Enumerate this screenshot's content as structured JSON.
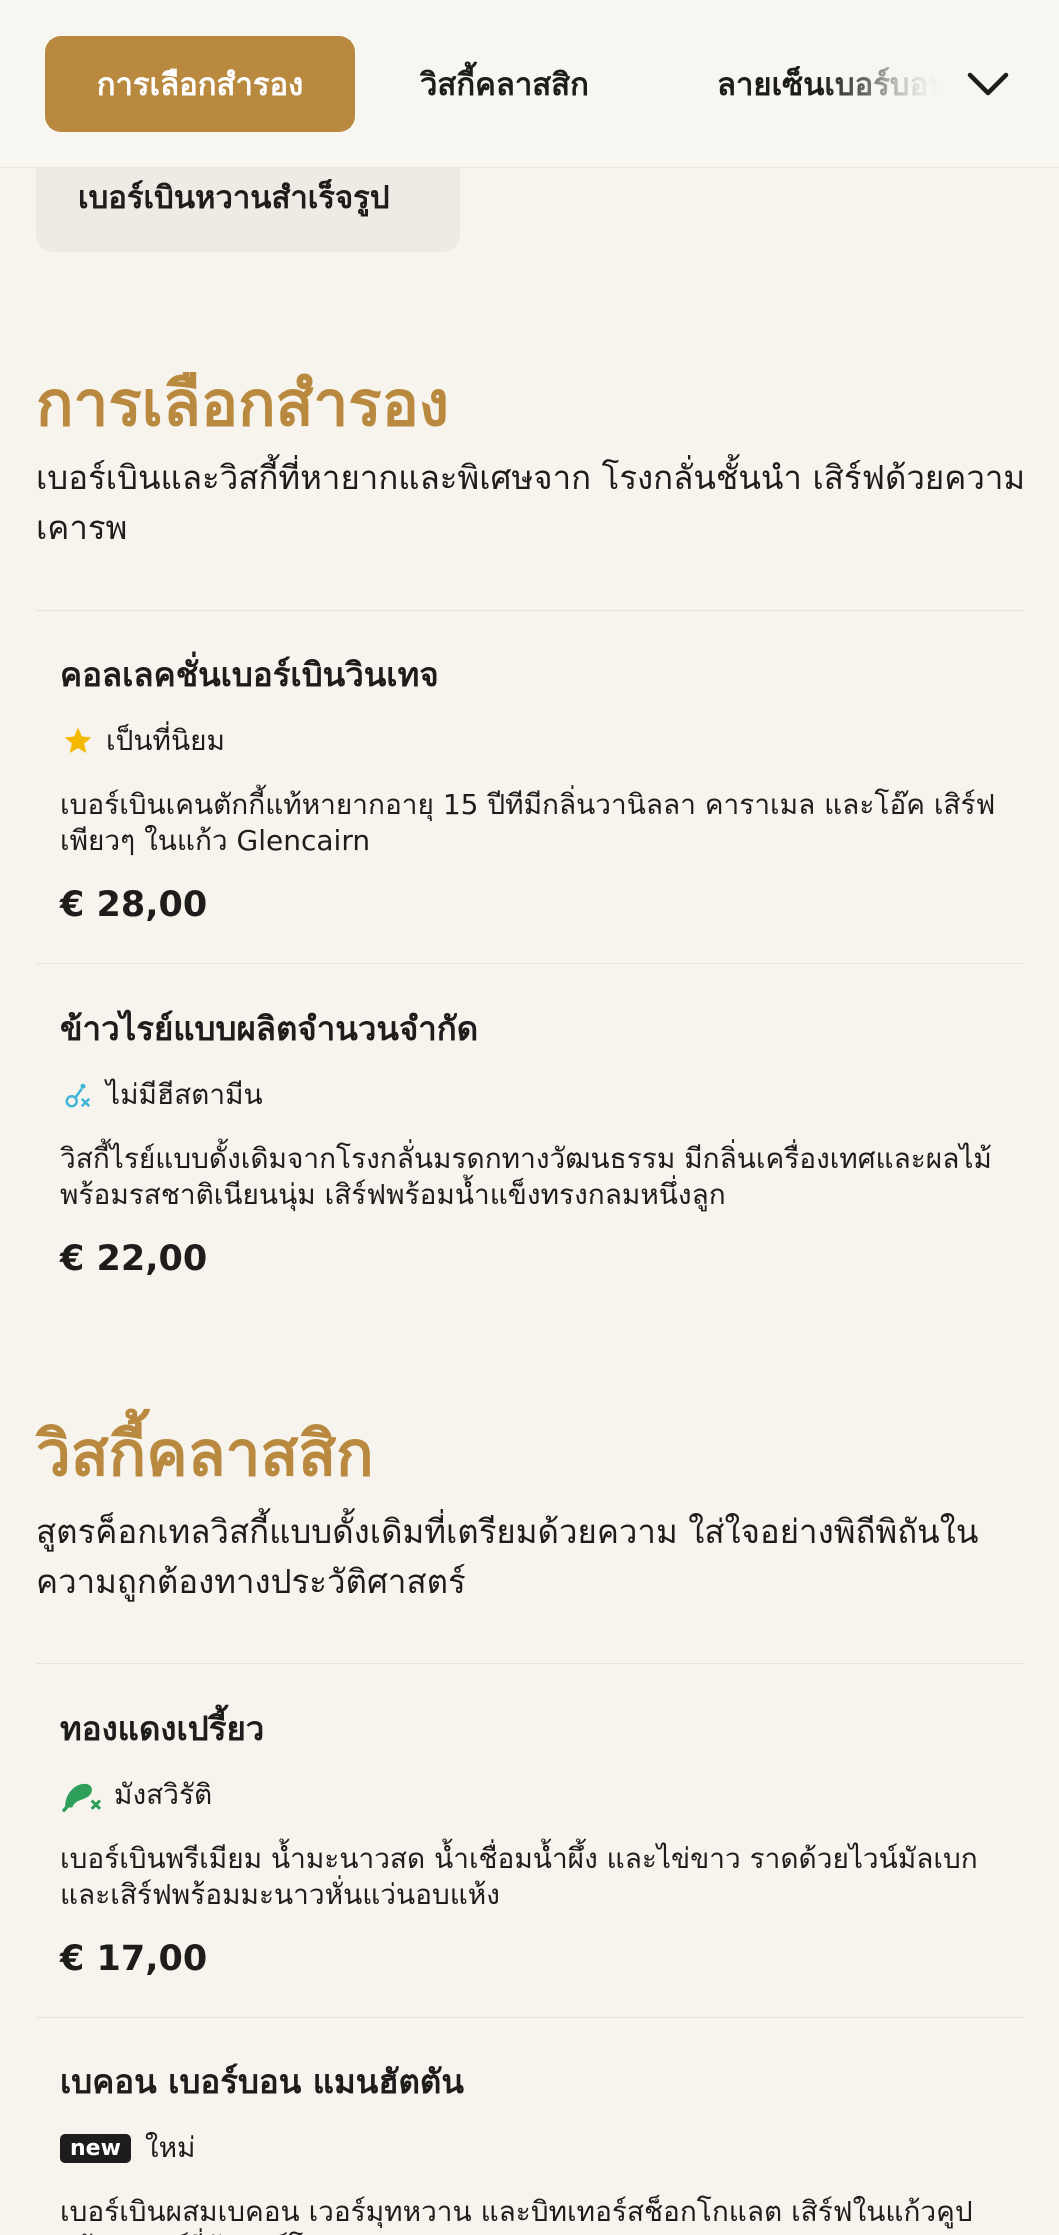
{
  "tabs": {
    "active_label": "การเลือกสำรอง",
    "tab2_label": "วิสกี้คลาสสิก",
    "tab3_label": "ลายเซ็นเบอร์บอน"
  },
  "chip_label": "เบอร์เบินหวานสำเร็จรูป",
  "sections": [
    {
      "title": "การเลือกสำรอง",
      "description": "เบอร์เบินและวิสกี้ที่หายากและพิเศษจาก โรงกลั่นชั้นนำ เสิร์ฟด้วยความเคารพ",
      "items": [
        {
          "name": "คอลเลคชั่นเบอร์เบินวินเทจ",
          "badge_icon": "star-icon",
          "badge_label": "เป็นที่นิยม",
          "description": "เบอร์เบินเคนตักกี้แท้หายากอายุ 15 ปีทีมีกลิ่นวานิลลา คาราเมล และโอ๊ค เสิร์ฟเพียวๆ ในแก้ว Glencairn",
          "price": "€ 28,00"
        },
        {
          "name": "ข้าวไรย์แบบผลิตจำนวนจำกัด",
          "badge_icon": "no-histamine-icon",
          "badge_label": "ไม่มีฮีสตามีน",
          "description": "วิสกี้ไรย์แบบดั้งเดิมจากโรงกลั่นมรดกทางวัฒนธรรม มีกลิ่นเครื่องเทศและผลไม้พร้อมรสชาติเนียนนุ่ม เสิร์ฟพร้อมน้ำแข็งทรงกลมหนึ่งลูก",
          "price": "€ 22,00"
        }
      ]
    },
    {
      "title": "วิสกี้คลาสสิก",
      "description": "สูตรค็อกเทลวิสกี้แบบดั้งเดิมที่เตรียมด้วยความ ใส่ใจอย่างพิถีพิถันในความถูกต้องทางประวัติศาสตร์",
      "items": [
        {
          "name": "ทองแดงเปรี้ยว",
          "badge_icon": "vegetarian-icon",
          "badge_label": "มังสวิรัติ",
          "description": "เบอร์เบินพรีเมียม น้ำมะนาวสด น้ำเชื่อมน้ำผึ้ง และไข่ขาว ราดด้วยไวน์มัลเบกและเสิร์ฟพร้อมมะนาวหั่นแว่นอบแห้ง",
          "price": "€ 17,00"
        },
        {
          "name": "เบคอน เบอร์บอน แมนฮัตตัน",
          "badge_icon": "new-tag",
          "badge_tag": "new",
          "badge_label": "ใหม่",
          "description": "เบอร์เบินผสมเบคอน เวอร์มุทหวาน และบิทเทอร์สช็อกโกแลต เสิร์ฟในแก้วคูปพร้อมเชอร์รี่ลักซาร์โดและเบคอนกรอบ",
          "price": ""
        }
      ]
    }
  ],
  "colors": {
    "accent": "#b9893f",
    "background": "#f7f4ee",
    "star": "#f5b800",
    "histamine": "#3fb6d8",
    "vegetarian": "#2e9e5b"
  }
}
